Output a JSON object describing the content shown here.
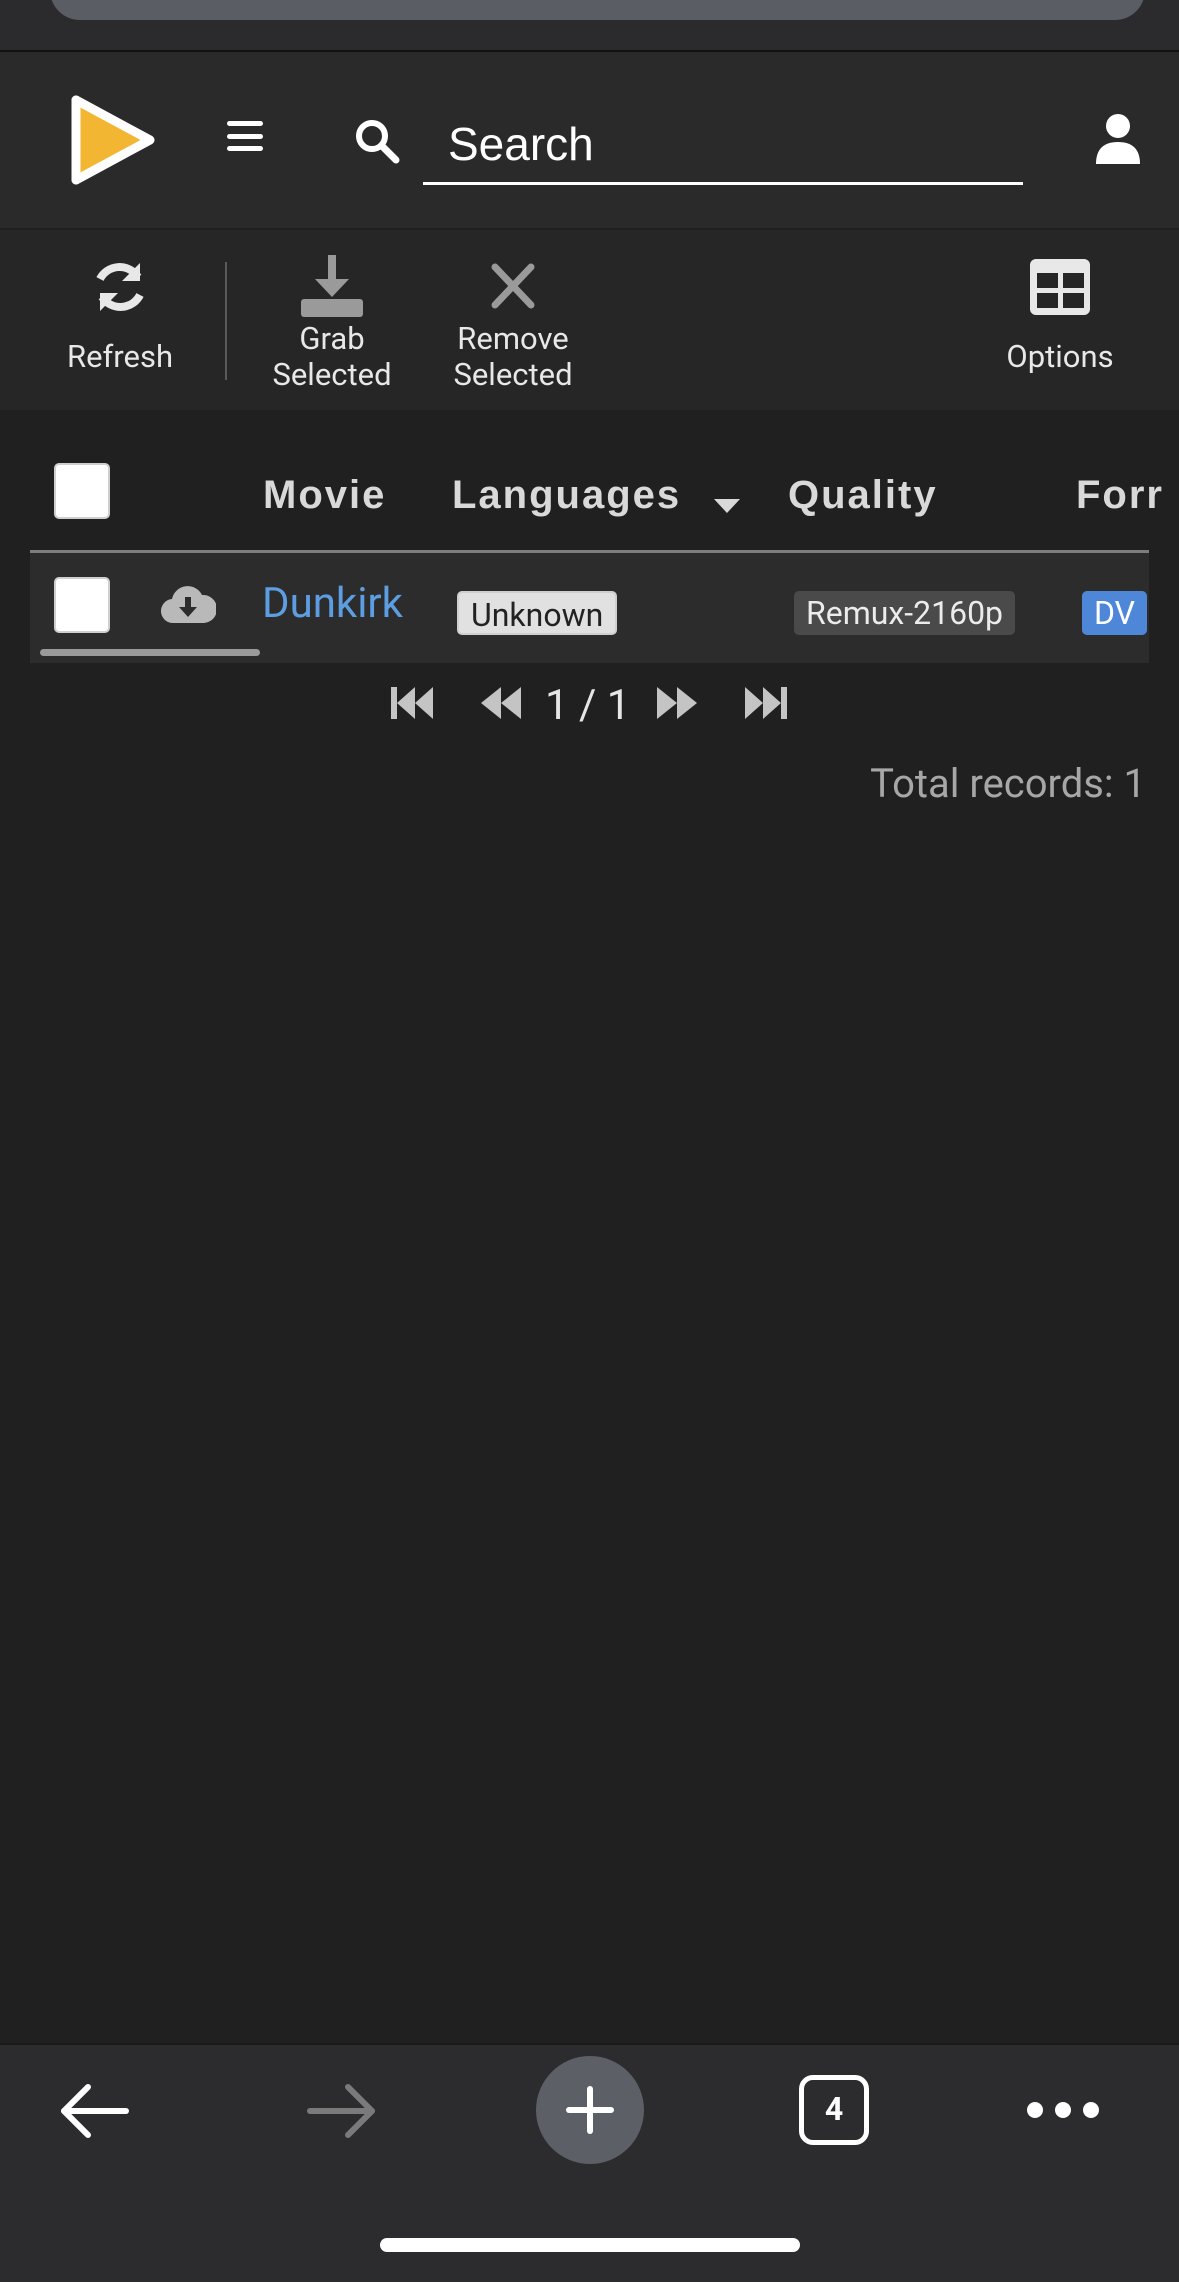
{
  "app": {
    "search_placeholder": "Search"
  },
  "toolbar": {
    "refresh_label": "Refresh",
    "grab_label_line1": "Grab",
    "grab_label_line2": "Selected",
    "remove_label_line1": "Remove",
    "remove_label_line2": "Selected",
    "options_label": "Options"
  },
  "table": {
    "columns": [
      "Movie",
      "Languages",
      "Quality",
      "Forr"
    ],
    "rows": [
      {
        "movie": "Dunkirk",
        "language": "Unknown",
        "quality": "Remux-2160p",
        "format": "DV"
      }
    ]
  },
  "pager": {
    "page_text": "1 / 1",
    "total_records": "Total records: 1"
  },
  "browser": {
    "tab_count": "4"
  },
  "colors": {
    "accent": "#5d9ee2",
    "logo_yellow": "#f3b632",
    "format_badge": "#4f87d8"
  },
  "icons": [
    "logo-icon",
    "hamburger-icon",
    "search-icon",
    "user-icon",
    "refresh-icon",
    "download-icon",
    "close-icon",
    "table-icon",
    "cloud-download-icon",
    "sort-caret-icon",
    "first-page-icon",
    "prev-page-icon",
    "next-page-icon",
    "last-page-icon",
    "back-arrow-icon",
    "forward-arrow-icon",
    "plus-icon",
    "tabs-icon",
    "more-icon"
  ]
}
